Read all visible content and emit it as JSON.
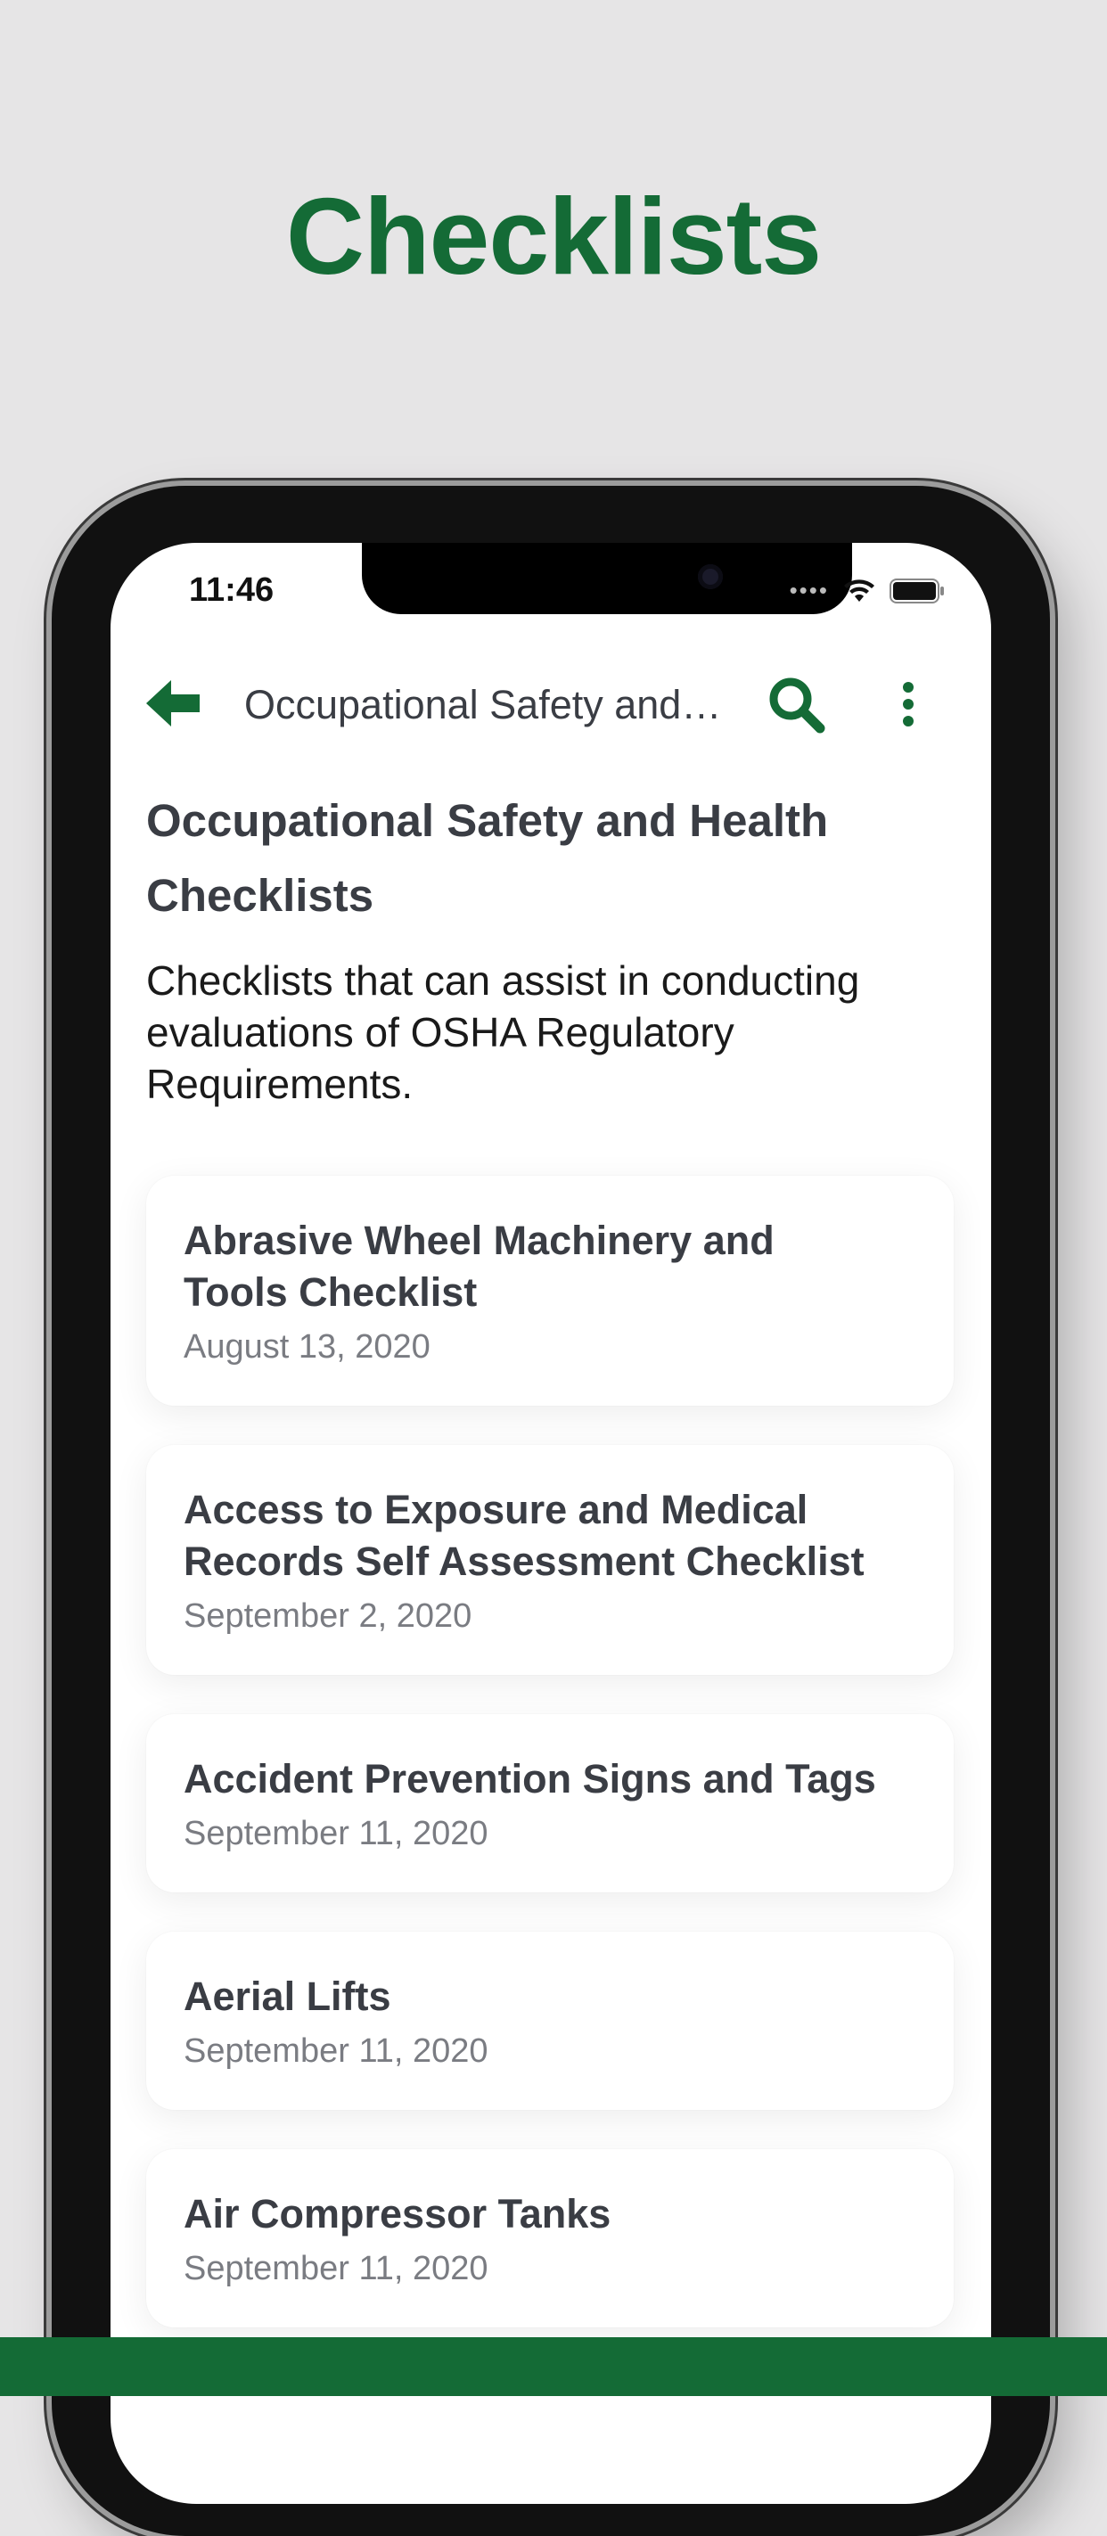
{
  "headline": "Checklists",
  "status": {
    "time": "11:46"
  },
  "navbar": {
    "title": "Occupational Safety and Health Checklists",
    "back_icon": "arrow-left-icon",
    "search_icon": "search-icon",
    "more_icon": "more-vertical-icon"
  },
  "page": {
    "heading": "Occupational Safety and Health Checklists",
    "description": "Checklists that can assist in conducting evaluations of OSHA Regulatory Requirements."
  },
  "checklists": [
    {
      "title": "Abrasive Wheel Machinery and Tools Checklist",
      "date": "August 13, 2020"
    },
    {
      "title": "Access to Exposure and Medical Records Self Assessment Checklist",
      "date": "September 2, 2020"
    },
    {
      "title": "Accident Prevention Signs and Tags",
      "date": "September 11, 2020"
    },
    {
      "title": "Aerial Lifts",
      "date": "September 11, 2020"
    },
    {
      "title": "Air Compressor Tanks",
      "date": "September 11, 2020"
    }
  ],
  "colors": {
    "brand_green": "#146b36",
    "background": "#e6e5e6",
    "text_dark": "#3a3d44",
    "text_muted": "#7a7c82"
  }
}
